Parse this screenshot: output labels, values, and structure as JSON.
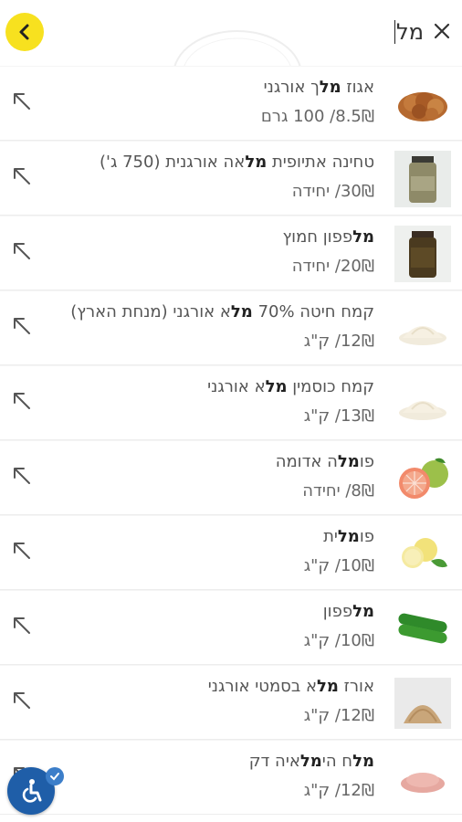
{
  "search": {
    "query": "מל"
  },
  "colors": {
    "accent": "#f7e11f",
    "a11y": "#1f5ea8"
  },
  "icons": {
    "back": "chevron-left-icon",
    "close": "close-icon",
    "arrow": "arrow-up-left-icon",
    "a11y": "wheelchair-icon"
  },
  "results": [
    {
      "name_parts": [
        "אגוז ",
        "מל",
        "ך אורגני"
      ],
      "bold": [
        1
      ],
      "price": "8.5₪/ 100 גרם",
      "thumb": "walnut"
    },
    {
      "name_parts": [
        "טחינה אתיופית ",
        "מל",
        "אה אורגנית (750 ג')"
      ],
      "bold": [
        1
      ],
      "price": "30₪/ יחידה",
      "thumb": "jar-light"
    },
    {
      "name_parts": [
        "מל",
        "פפון חמוץ"
      ],
      "bold": [
        0
      ],
      "price": "20₪/ יחידה",
      "thumb": "jar-dark"
    },
    {
      "name_parts": [
        "קמח חיטה 70% ",
        "מל",
        "א אורגני (מנחת הארץ)"
      ],
      "bold": [
        1
      ],
      "price": "12₪/ ק\"ג",
      "thumb": "flour"
    },
    {
      "name_parts": [
        "קמח כוסמין ",
        "מל",
        "א אורגני"
      ],
      "bold": [
        1
      ],
      "price": "13₪/ ק\"ג",
      "thumb": "flour"
    },
    {
      "name_parts": [
        "פו",
        "מל",
        "ה אדומה"
      ],
      "bold": [
        1
      ],
      "price": "8₪/ יחידה",
      "thumb": "pomelo-red"
    },
    {
      "name_parts": [
        "פו",
        "מל",
        "ית"
      ],
      "bold": [
        1
      ],
      "price": "10₪/ ק\"ג",
      "thumb": "pomelit"
    },
    {
      "name_parts": [
        "מל",
        "פפון"
      ],
      "bold": [
        0
      ],
      "price": "10₪/ ק\"ג",
      "thumb": "cucumber"
    },
    {
      "name_parts": [
        "אורז ",
        "מל",
        "א בסמטי אורגני"
      ],
      "bold": [
        1
      ],
      "price": "12₪/ ק\"ג",
      "thumb": "rice"
    },
    {
      "name_parts": [
        "מל",
        "ח הי",
        "מל",
        "איה דק"
      ],
      "bold": [
        0,
        2
      ],
      "price": "12₪/ ק\"ג",
      "thumb": "salt"
    }
  ]
}
